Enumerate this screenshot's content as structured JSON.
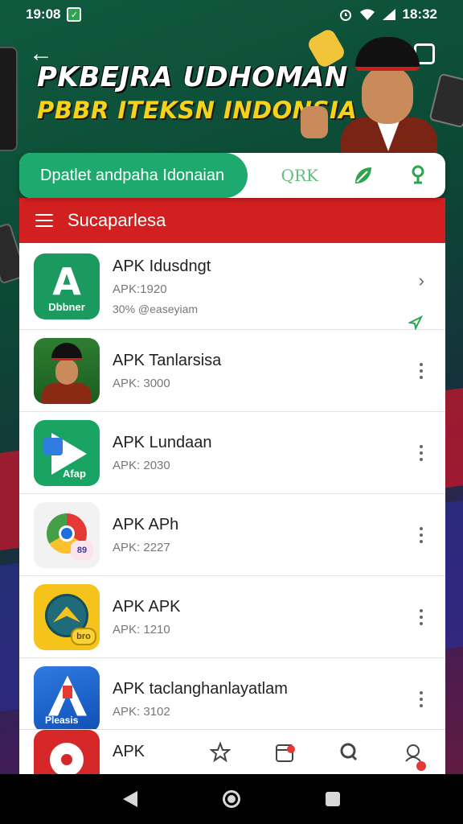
{
  "status_bar": {
    "time": "19:08",
    "right_time": "18:32",
    "icons": [
      "check-icon",
      "alarm-icon",
      "wifi-icon",
      "signal-icon"
    ]
  },
  "banner": {
    "title_line1": "PKBEJRA UDHOMAN",
    "title_line2": "PBBR ITEKSN INDONSIA"
  },
  "search": {
    "placeholder": "Dpatlet andpaha Idonaian",
    "qr_label": "QRK"
  },
  "header": {
    "title": "Sucaparlesa"
  },
  "apps": [
    {
      "title": "APK Idusdngt",
      "subtitle": "APK:1920",
      "extra": "30% @easeyiam",
      "icon": "a-letter-icon",
      "icon_word": "Dbbner",
      "action": "chevron-right-icon"
    },
    {
      "title": "APK Tanlarsisa",
      "subtitle": "APK: 3000",
      "icon": "person-icon",
      "action": "more-vert-icon"
    },
    {
      "title": "APK Lundaan",
      "subtitle": "APK: 2030",
      "icon": "play-store-icon",
      "icon_word": "Afap",
      "action": "more-vert-icon"
    },
    {
      "title": "APK APh",
      "subtitle": "APK: 2227",
      "icon": "chrome-icon",
      "icon_word": "89",
      "action": "more-vert-icon"
    },
    {
      "title": "APK APK",
      "subtitle": "APK: 1210",
      "icon": "garuda-icon",
      "icon_word": "bro",
      "action": "more-vert-icon"
    },
    {
      "title": "APK taclanghanlayatlam",
      "subtitle": "APK: 3102",
      "icon": "rocket-icon",
      "icon_word": "Pleasis",
      "action": "more-vert-icon"
    },
    {
      "title": "APK",
      "icon": "red-circle-icon"
    }
  ],
  "tabs": [
    {
      "icon": "star-icon"
    },
    {
      "icon": "calendar-icon",
      "badge": true
    },
    {
      "icon": "search-person-icon"
    },
    {
      "icon": "account-icon",
      "badge": true
    }
  ],
  "colors": {
    "green": "#1eaa6f",
    "red_header": "#d21f1f",
    "banner_yellow": "#f7d21a"
  }
}
